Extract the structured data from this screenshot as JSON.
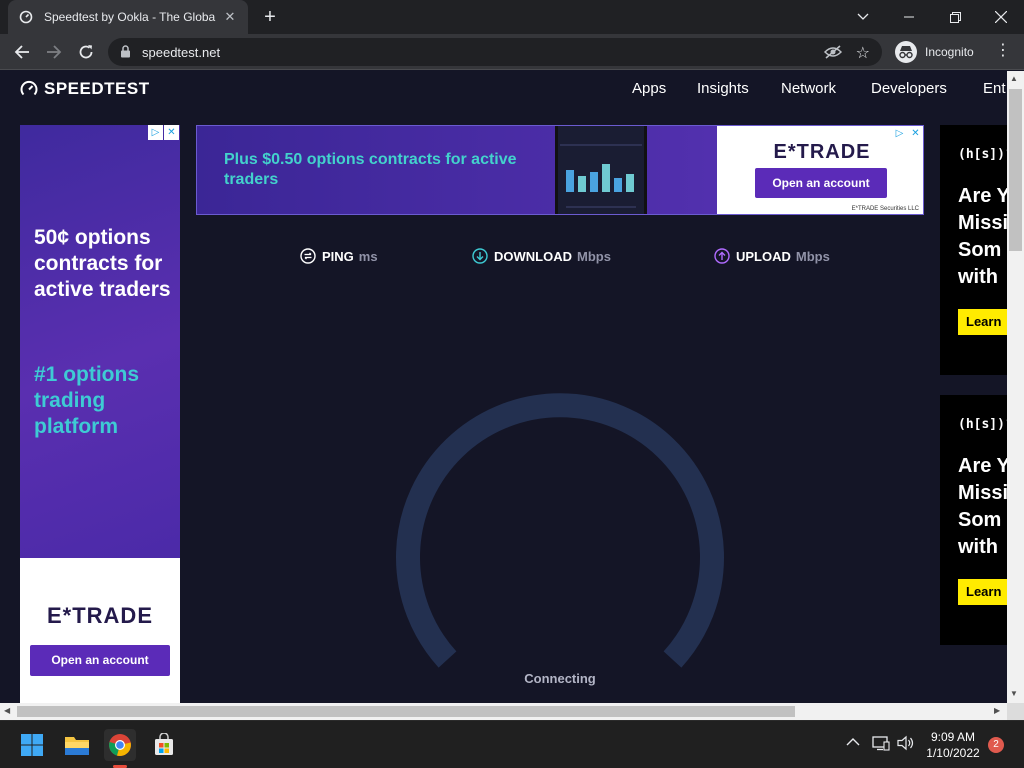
{
  "browser": {
    "tab_title": "Speedtest by Ookla - The Global",
    "url": "speedtest.net",
    "profile_label": "Incognito"
  },
  "site": {
    "logo_text": "SPEEDTEST",
    "nav": [
      "Apps",
      "Insights",
      "Network",
      "Developers",
      "Ent"
    ]
  },
  "metrics": {
    "ping": {
      "label": "PING",
      "unit": "ms"
    },
    "download": {
      "label": "DOWNLOAD",
      "unit": "Mbps"
    },
    "upload": {
      "label": "UPLOAD",
      "unit": "Mbps"
    }
  },
  "gauge": {
    "status": "Connecting"
  },
  "ads": {
    "left": {
      "headline": "50¢ options contracts for active traders",
      "subhead": "#1 options trading platform",
      "logo": "E*TRADE",
      "button": "Open an account"
    },
    "top": {
      "text": "Plus $0.50 options contracts for active traders",
      "logo": "E*TRADE",
      "button": "Open an account",
      "legal": "E*TRADE Securities LLC"
    },
    "right": {
      "brand": "(h[s])°",
      "headline_lines": [
        "Are Y",
        "Missi",
        "Som",
        "with"
      ],
      "button": "Learn"
    }
  },
  "taskbar": {
    "time": "9:09 AM",
    "date": "1/10/2022",
    "notifications": "2"
  },
  "colors": {
    "page_bg": "#141526",
    "gauge_track": "#233050",
    "ping_icon": "#ffffff",
    "download_icon": "#3ecbd4",
    "upload_icon": "#b06bff"
  }
}
